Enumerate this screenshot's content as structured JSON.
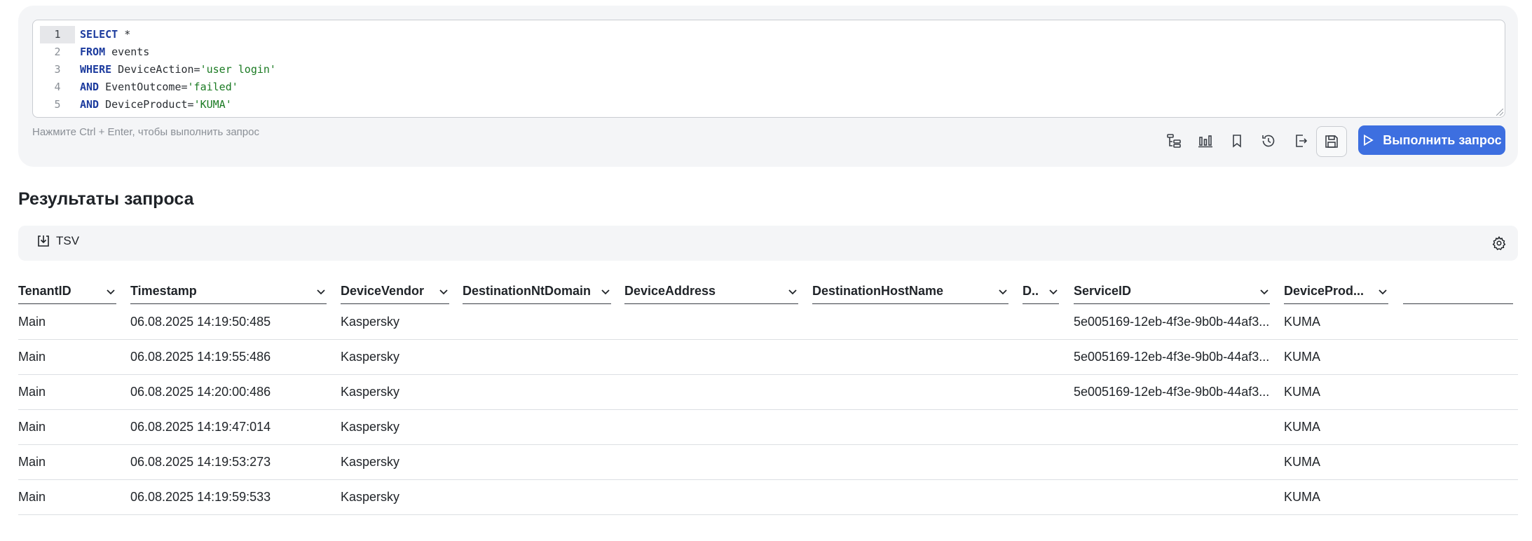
{
  "editor": {
    "line_numbers": [
      "1",
      "2",
      "3",
      "4",
      "5"
    ],
    "lines": [
      [
        {
          "t": "SELECT",
          "c": "kw"
        },
        {
          "t": " *",
          "c": "id"
        }
      ],
      [
        {
          "t": "FROM",
          "c": "kw"
        },
        {
          "t": " events",
          "c": "id"
        }
      ],
      [
        {
          "t": "WHERE",
          "c": "kw"
        },
        {
          "t": " DeviceAction=",
          "c": "id"
        },
        {
          "t": "'user login'",
          "c": "str"
        }
      ],
      [
        {
          "t": "AND",
          "c": "kw"
        },
        {
          "t": " EventOutcome=",
          "c": "id"
        },
        {
          "t": "'failed'",
          "c": "str"
        }
      ],
      [
        {
          "t": "AND",
          "c": "kw"
        },
        {
          "t": " DeviceProduct=",
          "c": "id"
        },
        {
          "t": "'KUMA'",
          "c": "str"
        }
      ]
    ],
    "hint": "Нажмите Ctrl + Enter, чтобы выполнить запрос"
  },
  "toolbar": {
    "tools": [
      "tree-icon",
      "bar-chart-icon",
      "bookmark-icon",
      "history-icon",
      "export-icon",
      "save-icon"
    ],
    "run_label": "Выполнить запрос"
  },
  "results": {
    "title": "Результаты запроса",
    "export_label": "TSV",
    "columns": [
      "TenantID",
      "Timestamp",
      "DeviceVendor",
      "DestinationNtDomain",
      "DeviceAddress",
      "DestinationHostName",
      "D..",
      "ServiceID",
      "DeviceProd...",
      ""
    ],
    "rows": [
      [
        "Main",
        "06.08.2025 14:19:50:485",
        "Kaspersky",
        "",
        "",
        "",
        "",
        "5e005169-12eb-4f3e-9b0b-44af3...",
        "KUMA",
        ""
      ],
      [
        "Main",
        "06.08.2025 14:19:55:486",
        "Kaspersky",
        "",
        "",
        "",
        "",
        "5e005169-12eb-4f3e-9b0b-44af3...",
        "KUMA",
        ""
      ],
      [
        "Main",
        "06.08.2025 14:20:00:486",
        "Kaspersky",
        "",
        "",
        "",
        "",
        "5e005169-12eb-4f3e-9b0b-44af3...",
        "KUMA",
        ""
      ],
      [
        "Main",
        "06.08.2025 14:19:47:014",
        "Kaspersky",
        "",
        "",
        "",
        "",
        "",
        "KUMA",
        ""
      ],
      [
        "Main",
        "06.08.2025 14:19:53:273",
        "Kaspersky",
        "",
        "",
        "",
        "",
        "",
        "KUMA",
        ""
      ],
      [
        "Main",
        "06.08.2025 14:19:59:533",
        "Kaspersky",
        "",
        "",
        "",
        "",
        "",
        "KUMA",
        ""
      ]
    ]
  },
  "colors": {
    "accent": "#3d6fe0",
    "panel": "#f4f5f7",
    "keyword": "#1c3b9e",
    "string": "#1a7a22"
  }
}
